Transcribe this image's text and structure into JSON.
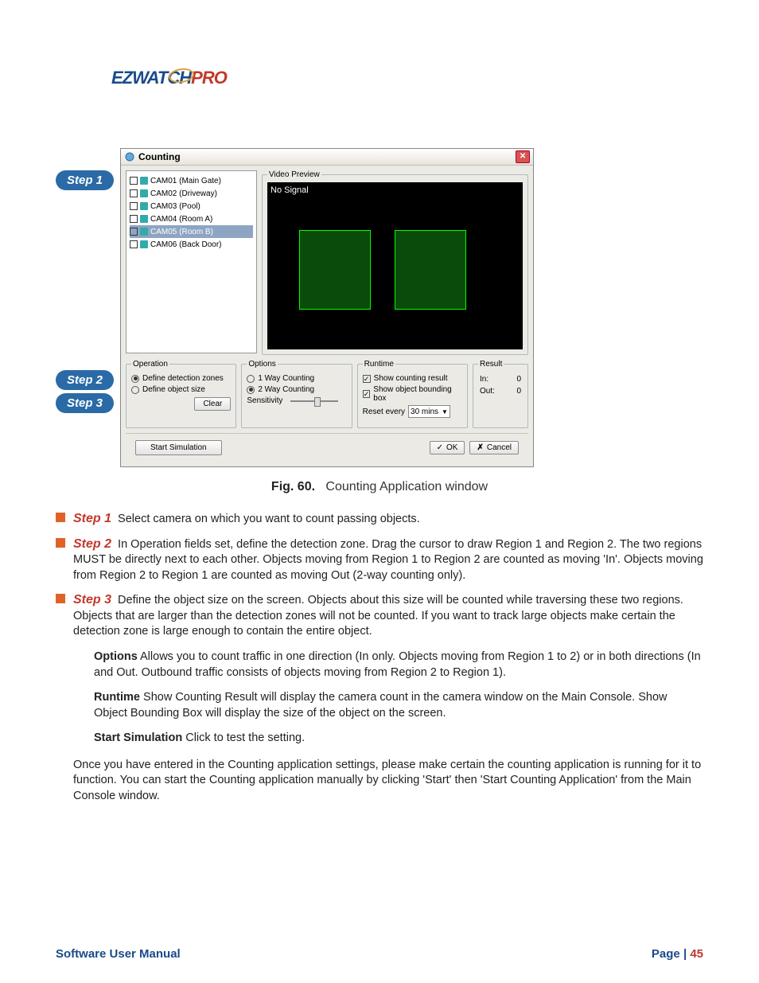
{
  "logo": {
    "part1": "EZ",
    "part2": "WATCH",
    "part3": "PRO"
  },
  "labels": {
    "step1": "Step 1",
    "step2": "Step 2",
    "step3": "Step 3"
  },
  "window": {
    "title": "Counting",
    "camlist": [
      "CAM01 (Main Gate)",
      "CAM02 (Driveway)",
      "CAM03 (Pool)",
      "CAM04 (Room A)",
      "CAM05 (Room B)",
      "CAM06 (Back Door)"
    ],
    "selected_cam_index": 4,
    "preview": {
      "legend": "Video Preview",
      "text": "No  Signal"
    },
    "operation": {
      "legend": "Operation",
      "opt1": "Define detection zones",
      "opt2": "Define object size",
      "clear": "Clear"
    },
    "options": {
      "legend": "Options",
      "opt1": "1 Way Counting",
      "opt2": "2 Way Counting",
      "sensitivity": "Sensitivity"
    },
    "runtime": {
      "legend": "Runtime",
      "chk1": "Show counting result",
      "chk2": "Show object bounding box",
      "reset": "Reset every",
      "reset_value": "30 mins"
    },
    "result": {
      "legend": "Result",
      "in_label": "In:",
      "in_value": "0",
      "out_label": "Out:",
      "out_value": "0"
    },
    "start_sim": "Start Simulation",
    "ok": "OK",
    "cancel": "Cancel"
  },
  "caption": {
    "label": "Fig. 60.",
    "text": "Counting Application window"
  },
  "instructions": {
    "s1": {
      "label": "Step 1",
      "text": "Select camera on which you want to count passing objects."
    },
    "s2": {
      "label": "Step 2",
      "text": "In Operation fields set, define the detection zone. Drag the cursor to draw Region 1 and Region 2. The two regions MUST be directly next to each other. Objects moving from Region 1 to Region 2 are counted as moving 'In'. Objects moving from Region 2 to Region 1 are counted as moving Out (2-way counting only)."
    },
    "s3": {
      "label": "Step 3",
      "text": "Define the object size on the screen. Objects about this size will be counted while traversing these two regions. Objects that are larger than the detection zones will not be counted. If you want to track large objects make certain the detection zone is large enough to contain the entire object."
    },
    "options": {
      "label": "Options",
      "text": "Allows you to count traffic in one direction (In only. Objects moving from Region 1 to 2) or in both directions (In and Out. Outbound traffic consists of objects moving from Region 2 to Region 1)."
    },
    "runtime": {
      "label": "Runtime",
      "text": "Show Counting Result will display the camera count in the camera window on the Main Console. Show Object Bounding Box will display the size of the object on the screen."
    },
    "startsim": {
      "label": "Start Simulation",
      "text": "Click to test the setting."
    },
    "final": "Once you have entered in the Counting application settings, please make certain the counting application is running for it to function. You can start the Counting application manually by clicking 'Start' then 'Start Counting Application' from the Main Console window."
  },
  "footer": {
    "left": "Software User Manual",
    "page_label": "Page | ",
    "page_num": "45"
  }
}
